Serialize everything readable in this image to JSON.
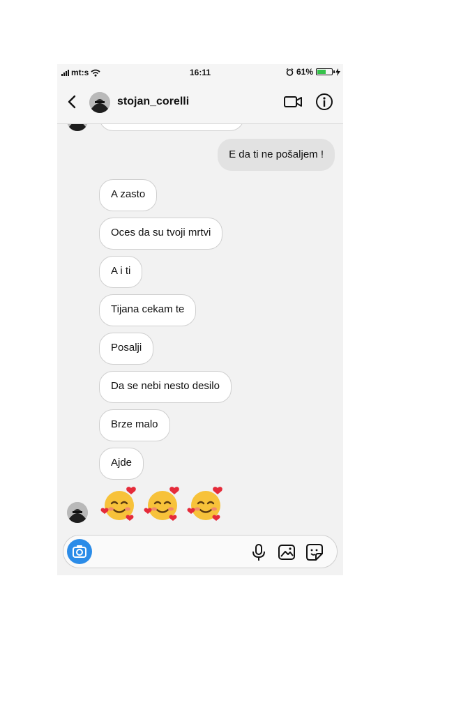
{
  "status_bar": {
    "carrier": "mt:s",
    "time": "16:11",
    "battery_percent": "61%",
    "battery_level": 0.61,
    "battery_color": "#35c24a"
  },
  "header": {
    "username": "stojan_corelli",
    "icons": [
      "back-chevron-icon",
      "video-camera-icon",
      "info-icon"
    ]
  },
  "messages": [
    {
      "side": "out",
      "text": "E da ti ne pošaljem !"
    },
    {
      "side": "in",
      "text": "A zasto"
    },
    {
      "side": "in",
      "text": "Oces da su tvoji mrtvi"
    },
    {
      "side": "in",
      "text": "A i ti"
    },
    {
      "side": "in",
      "text": "Tijana cekam te"
    },
    {
      "side": "in",
      "text": "Posalji"
    },
    {
      "side": "in",
      "text": "Da se nebi nesto desilo"
    },
    {
      "side": "in",
      "text": "Brze malo"
    },
    {
      "side": "in",
      "text": "Ajde"
    }
  ],
  "emoji_message": {
    "emoji_name": "smiling-face-with-hearts",
    "count": 3
  },
  "composer": {
    "placeholder": "",
    "icons": [
      "camera-icon",
      "microphone-icon",
      "gallery-icon",
      "sticker-icon"
    ],
    "camera_color": "#2b8ce8"
  }
}
